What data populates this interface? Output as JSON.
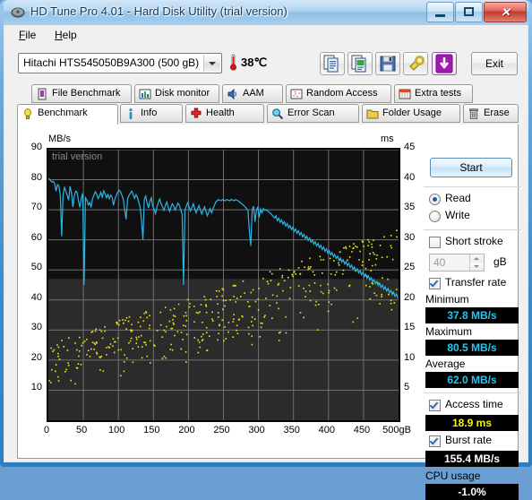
{
  "window": {
    "title": "HD Tune Pro 4.01 - Hard Disk Utility (trial version)",
    "icon": "disk-icon",
    "minimize_label": "–",
    "maximize_label": "□",
    "close_label": "✕"
  },
  "menu": [
    {
      "label": "File",
      "accel": "F"
    },
    {
      "label": "Help",
      "accel": "H"
    }
  ],
  "toolbar": {
    "drive": "Hitachi HTS545050B9A300 (500 gB)",
    "temperature": "38℃",
    "thermometer_icon": "thermometer-icon",
    "buttons": [
      {
        "name": "copy-icon",
        "label": "Copy"
      },
      {
        "name": "copy-image-icon",
        "label": "Copy image"
      },
      {
        "name": "save-icon",
        "label": "Save"
      },
      {
        "name": "settings-icon",
        "label": "Options"
      },
      {
        "name": "download-icon",
        "label": "Check for update"
      }
    ],
    "exit_label": "Exit"
  },
  "tabs_row1": [
    {
      "label": "File Benchmark",
      "icon": "file-benchmark-icon"
    },
    {
      "label": "Disk monitor",
      "icon": "disk-monitor-icon"
    },
    {
      "label": "AAM",
      "icon": "speaker-icon"
    },
    {
      "label": "Random Access",
      "icon": "random-access-icon"
    },
    {
      "label": "Extra tests",
      "icon": "extra-tests-icon"
    }
  ],
  "tabs_row2": [
    {
      "label": "Benchmark",
      "icon": "bulb-icon",
      "active": true
    },
    {
      "label": "Info",
      "icon": "info-icon",
      "active": false
    },
    {
      "label": "Health",
      "icon": "health-icon",
      "active": false
    },
    {
      "label": "Error Scan",
      "icon": "magnifier-icon",
      "active": false
    },
    {
      "label": "Folder Usage",
      "icon": "folder-icon",
      "active": false
    },
    {
      "label": "Erase",
      "icon": "trash-icon",
      "active": false
    }
  ],
  "panel": {
    "start_label": "Start",
    "mode_read": "Read",
    "mode_write": "Write",
    "mode_selected": "Read",
    "short_stroke_label": "Short stroke",
    "short_stroke_checked": false,
    "short_stroke_value": "40",
    "short_stroke_unit": "gB",
    "transfer_rate_label": "Transfer rate",
    "transfer_rate_checked": true,
    "minimum_label": "Minimum",
    "minimum_value": "37.8 MB/s",
    "maximum_label": "Maximum",
    "maximum_value": "80.5 MB/s",
    "average_label": "Average",
    "average_value": "62.0 MB/s",
    "access_time_label": "Access time",
    "access_time_checked": true,
    "access_time_value": "18.9 ms",
    "burst_rate_label": "Burst rate",
    "burst_rate_checked": true,
    "burst_rate_value": "155.4 MB/s",
    "cpu_usage_label": "CPU usage",
    "cpu_usage_value": "-1.0%",
    "colors": {
      "value_cyan": "#21c8f0",
      "value_yellow": "#f2f21e",
      "value_white": "#ffffff"
    }
  },
  "chart_data": {
    "type": "line",
    "title": "",
    "watermark": "trial version",
    "xlabel": "",
    "ylabel": "MB/s",
    "y2label": "ms",
    "xlim": [
      0,
      500
    ],
    "ylim": [
      0,
      90
    ],
    "y2lim": [
      0,
      45
    ],
    "xticks": [
      0,
      50,
      100,
      150,
      200,
      250,
      300,
      350,
      400,
      450,
      500
    ],
    "xtick_labels": [
      "0",
      "50",
      "100",
      "150",
      "200",
      "250",
      "300",
      "350",
      "400",
      "450",
      "500gB"
    ],
    "yticks": [
      10,
      20,
      30,
      40,
      50,
      60,
      70,
      80,
      90
    ],
    "y2ticks": [
      5,
      10,
      15,
      20,
      25,
      30,
      35,
      40,
      45
    ],
    "grid": true,
    "legend": "none",
    "background": "#1c1c1c",
    "series": [
      {
        "name": "Transfer rate",
        "axis": "left",
        "color": "#29b6e8",
        "unit": "MB/s",
        "x": [
          0,
          3,
          5,
          7,
          9,
          11,
          13,
          15,
          17,
          19,
          21,
          23,
          25,
          27,
          29,
          31,
          33,
          35,
          37,
          39,
          41,
          43,
          45,
          47,
          49,
          51,
          53,
          55,
          57,
          59,
          61,
          63,
          65,
          67,
          69,
          71,
          73,
          75,
          77,
          79,
          81,
          83,
          85,
          87,
          89,
          91,
          93,
          95,
          97,
          99,
          101,
          103,
          105,
          107,
          109,
          111,
          113,
          115,
          117,
          119,
          121,
          123,
          125,
          127,
          129,
          131,
          133,
          135,
          137,
          139,
          141,
          143,
          145,
          147,
          149,
          151,
          153,
          155,
          157,
          159,
          161,
          163,
          165,
          167,
          169,
          171,
          173,
          175,
          177,
          179,
          181,
          183,
          185,
          187,
          189,
          191,
          193,
          195,
          197,
          199,
          201,
          203,
          205,
          207,
          209,
          211,
          213,
          215,
          217,
          219,
          221,
          223,
          225,
          227,
          229,
          231,
          233,
          235,
          237,
          239,
          241,
          243,
          245,
          247,
          249,
          251,
          253,
          255,
          257,
          259,
          261,
          263,
          265,
          267,
          269,
          271,
          273,
          275,
          277,
          279,
          281,
          283,
          285,
          287,
          289,
          291,
          293,
          295,
          297,
          299,
          301,
          303,
          305,
          307,
          309,
          311,
          313,
          315,
          317,
          319,
          321,
          323,
          325,
          327,
          329,
          331,
          333,
          335,
          337,
          339,
          341,
          343,
          345,
          347,
          349,
          351,
          353,
          355,
          357,
          359,
          361,
          363,
          365,
          367,
          369,
          371,
          373,
          375,
          377,
          379,
          381,
          383,
          385,
          387,
          389,
          391,
          393,
          395,
          397,
          399,
          401,
          403,
          405,
          407,
          409,
          411,
          413,
          415,
          417,
          419,
          421,
          423,
          425,
          427,
          429,
          431,
          433,
          435,
          437,
          439,
          441,
          443,
          445,
          447,
          449,
          451,
          453,
          455,
          457,
          459,
          461,
          463,
          465,
          467,
          469,
          471,
          473,
          475,
          477,
          479,
          481,
          483,
          485,
          487,
          489,
          491,
          493,
          495,
          497,
          499
        ],
        "y": [
          80.5,
          79.8,
          79.2,
          79.5,
          78.7,
          76.2,
          78.4,
          77.9,
          75.0,
          61.2,
          74.8,
          77.6,
          76.0,
          74.8,
          73.2,
          77.8,
          75.6,
          70.9,
          74.6,
          76.2,
          75.8,
          73.0,
          70.8,
          73.9,
          75.5,
          45.0,
          74.0,
          73.2,
          71.6,
          72.4,
          71.0,
          73.6,
          74.9,
          76.0,
          75.2,
          73.8,
          74.6,
          75.8,
          74.2,
          76.3,
          75.4,
          74.0,
          75.1,
          73.7,
          74.9,
          74.2,
          71.5,
          73.6,
          74.8,
          75.9,
          76.5,
          76.0,
          74.8,
          73.4,
          70.1,
          66.8,
          73.5,
          74.7,
          75.5,
          76.2,
          75.1,
          73.8,
          75.0,
          74.2,
          72.6,
          71.0,
          66.5,
          60.0,
          73.4,
          74.6,
          72.2,
          70.6,
          72.8,
          74.0,
          71.2,
          70.2,
          68.7,
          70.8,
          72.4,
          73.6,
          72.0,
          70.9,
          69.8,
          71.4,
          72.6,
          71.0,
          69.5,
          70.8,
          72.0,
          71.2,
          69.9,
          71.0,
          72.2,
          71.5,
          70.0,
          68.4,
          45.0,
          69.8,
          71.2,
          72.4,
          71.0,
          69.6,
          70.8,
          72.0,
          70.4,
          69.0,
          70.2,
          71.4,
          70.0,
          68.6,
          69.8,
          71.0,
          69.4,
          68.0,
          69.2,
          70.4,
          69.0,
          70.2,
          71.4,
          72.6,
          73.0,
          73.4,
          73.2,
          73.0,
          73.4,
          73.2,
          73.0,
          73.4,
          73.2,
          73.0,
          73.4,
          73.2,
          73.0,
          73.4,
          73.2,
          73.0,
          72.6,
          72.2,
          71.8,
          71.4,
          71.0,
          70.4,
          69.8,
          63.0,
          58.0,
          70.0,
          71.2,
          66.0,
          69.8,
          71.0,
          67.5,
          70.2,
          69.0,
          70.4,
          69.8,
          70.0,
          69.6,
          69.2,
          68.8,
          68.4,
          67.8,
          67.2,
          68.0,
          66.4,
          67.2,
          65.8,
          66.6,
          65.2,
          66.0,
          64.6,
          65.4,
          64.0,
          64.8,
          63.4,
          64.2,
          62.8,
          63.6,
          62.2,
          63.0,
          61.6,
          62.4,
          61.0,
          61.8,
          60.4,
          61.2,
          59.8,
          60.6,
          59.2,
          60.0,
          58.6,
          59.4,
          58.0,
          58.8,
          57.4,
          58.2,
          56.8,
          57.6,
          56.2,
          57.0,
          55.6,
          56.4,
          55.0,
          55.8,
          54.4,
          55.2,
          53.8,
          54.6,
          53.2,
          54.0,
          52.6,
          53.4,
          52.0,
          52.8,
          51.4,
          52.2,
          50.8,
          51.6,
          50.2,
          51.0,
          49.6,
          50.4,
          49.0,
          49.8,
          48.4,
          49.2,
          47.8,
          48.6,
          47.2,
          48.0,
          46.6,
          47.4,
          46.0,
          46.8,
          45.4,
          46.2,
          44.8,
          45.6,
          44.2,
          45.0,
          43.6,
          44.4,
          43.0,
          43.8,
          42.4,
          43.2,
          41.8,
          42.6,
          41.2,
          42.0,
          40.6,
          41.4,
          40.0,
          40.8,
          39.5,
          40.2,
          38.8,
          39.6,
          41.0,
          40.2,
          39.4,
          40.6,
          37.8,
          39.0,
          40.4
        ]
      },
      {
        "name": "Access time",
        "axis": "right",
        "color": "#ece81a",
        "unit": "ms",
        "marker": "dot",
        "average": 18.9,
        "note": "Scatter of ~420 random access samples; values rise from ~5 ms near the start of the disk to ~32 ms near the end. Dense cloud.",
        "band_low_start": 4.5,
        "band_high_start": 13.0,
        "band_low_end": 17.0,
        "band_high_end": 32.0
      }
    ]
  }
}
